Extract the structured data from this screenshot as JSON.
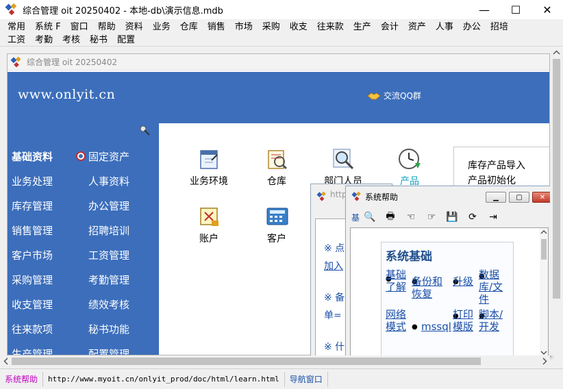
{
  "window": {
    "title": "综合管理 oit 20250402 - 本地-db\\演示信息.mdb",
    "minimize_glyph": "—",
    "maximize_glyph": "☐",
    "close_glyph": "✕"
  },
  "menu": {
    "row1": [
      "常用",
      "系统 F",
      "窗口",
      "帮助",
      "资料",
      "业务",
      "仓库",
      "销售",
      "市场",
      "采购",
      "收支",
      "往来款",
      "生产",
      "会计",
      "资产",
      "人事",
      "办公",
      "招培"
    ],
    "row2": [
      "工资",
      "考勤",
      "考核",
      "秘书",
      "配置"
    ]
  },
  "mdi": {
    "title": "综合管理 oit 20250402",
    "banner_url": "www.onlyit.cn",
    "qq_label": "交流QQ群"
  },
  "nav": {
    "left": [
      "基础资料",
      "业务处理",
      "库存管理",
      "销售管理",
      "客户市场",
      "采购管理",
      "收支管理",
      "往来款项",
      "生产管理"
    ],
    "right": [
      "固定资产",
      "人事资料",
      "办公管理",
      "招聘培训",
      "工资管理",
      "考勤管理",
      "绩效考核",
      "秘书功能",
      "配置管理"
    ]
  },
  "tiles": {
    "row1": [
      "业务环境",
      "仓库",
      "部门人员",
      "产品"
    ],
    "row2": [
      "账户",
      "客户"
    ]
  },
  "rightlist": [
    "库存产品导入",
    "产品初始化"
  ],
  "partial_window": {
    "caption": "http",
    "lines": [
      "※ 点",
      "加入",
      "※ 备",
      "单=",
      "※ 什"
    ]
  },
  "help": {
    "title": "系统帮助",
    "heading": "系统基础",
    "toolbar_first": "基",
    "links": [
      "基础了解",
      "备份和恢复",
      "升级",
      "数据库/文件",
      "网络模式",
      "mssql",
      "打印模版",
      "脚本/开发"
    ]
  },
  "status": {
    "help_link": "系统帮助",
    "url": "http://www.myoit.cn/onlyit_prod/doc/html/learn.html",
    "nav_window": "导航窗口"
  },
  "colors": {
    "banner_blue": "#3c6ebb",
    "link_blue": "#1a4fa8",
    "status_magenta": "#c000c0"
  }
}
